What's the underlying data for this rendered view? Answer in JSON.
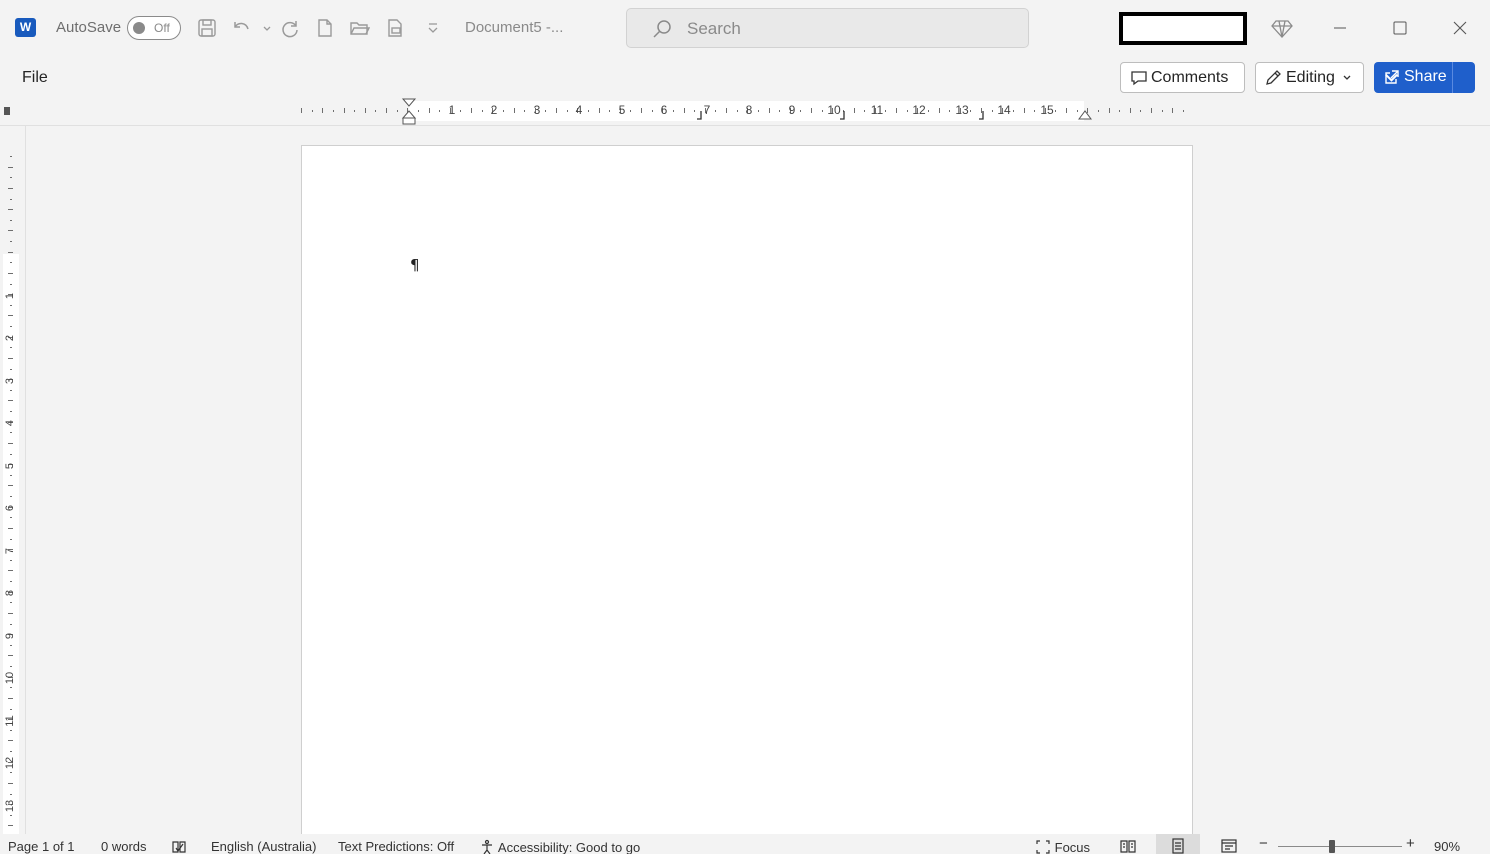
{
  "app": {
    "logo_letter": "W",
    "autosave_label": "AutoSave",
    "autosave_state": "Off",
    "document_name": "Document5 -...",
    "search_placeholder": "Search"
  },
  "menu": {
    "file_tab": "File",
    "comments_label": "Comments",
    "editing_label": "Editing",
    "share_label": "Share"
  },
  "ruler": {
    "h_numbers": [
      "1",
      "2",
      "3",
      "4",
      "5",
      "6",
      "7",
      "8",
      "9",
      "10",
      "11",
      "12",
      "13",
      "14",
      "15"
    ],
    "v_numbers": [
      "1",
      "2",
      "3",
      "4",
      "5",
      "6",
      "7",
      "8",
      "9",
      "10",
      "11",
      "12",
      "13"
    ]
  },
  "document": {
    "paragraph_mark": "¶"
  },
  "status": {
    "page": "Page 1 of 1",
    "words": "0 words",
    "language": "English (Australia)",
    "text_predictions": "Text Predictions: Off",
    "accessibility": "Accessibility: Good to go",
    "focus": "Focus",
    "zoom": "90%",
    "zoom_level": 0.9
  },
  "colors": {
    "accent": "#1f5fcb",
    "word_brand": "#185abd"
  }
}
